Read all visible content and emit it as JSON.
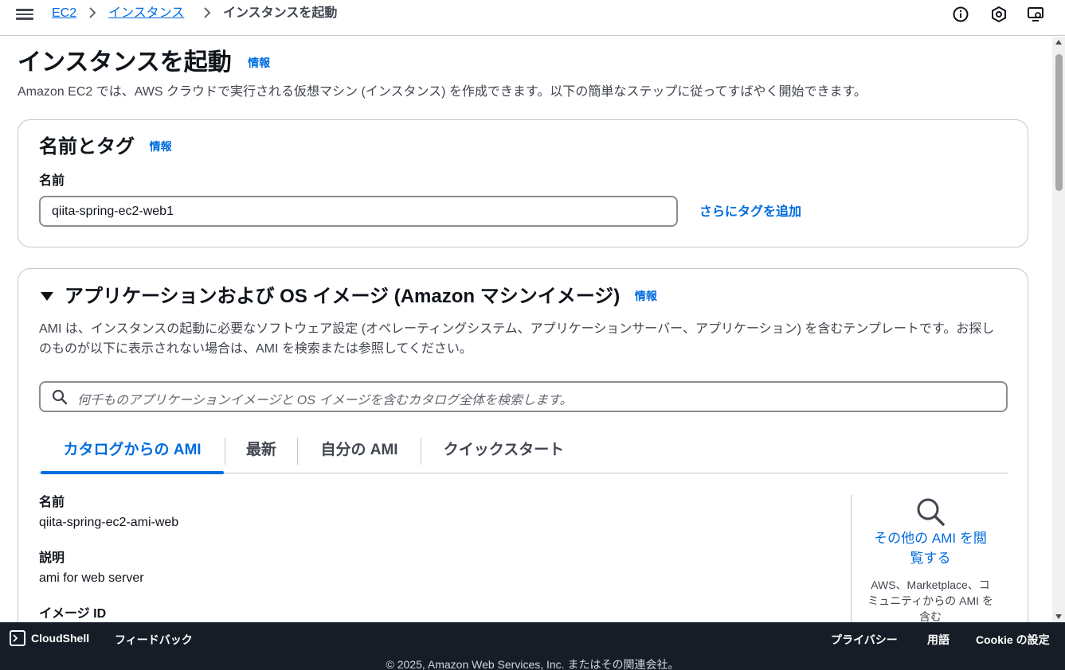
{
  "breadcrumb": {
    "items": [
      "EC2",
      "インスタンス",
      "インスタンスを起動"
    ]
  },
  "page": {
    "title": "インスタンスを起動",
    "info": "情報",
    "description": "Amazon EC2 では、AWS クラウドで実行される仮想マシン (インスタンス) を作成できます。以下の簡単なステップに従ってすばやく開始できます。"
  },
  "name_tags": {
    "title": "名前とタグ",
    "info": "情報",
    "name_label": "名前",
    "name_value": "qiita-spring-ec2-web1",
    "add_tags": "さらにタグを追加"
  },
  "ami": {
    "title": "アプリケーションおよび OS イメージ (Amazon マシンイメージ)",
    "info": "情報",
    "description": "AMI は、インスタンスの起動に必要なソフトウェア設定 (オペレーティングシステム、アプリケーションサーバー、アプリケーション) を含むテンプレートです。お探しのものが以下に表示されない場合は、AMI を検索または参照してください。",
    "search_placeholder": "何千ものアプリケーションイメージと OS イメージを含むカタログ全体を検索します。",
    "tabs": [
      "カタログからの AMI",
      "最新",
      "自分の AMI",
      "クイックスタート"
    ],
    "active_tab": 0,
    "details": {
      "name_label": "名前",
      "name_value": "qiita-spring-ec2-ami-web",
      "desc_label": "説明",
      "desc_value": "ami for web server",
      "image_id_label": "イメージ ID"
    },
    "browse": {
      "link": "その他の AMI を閲覧する",
      "sub": "AWS、Marketplace、コミュニティからの AMI を含む"
    }
  },
  "footer": {
    "cloudshell": "CloudShell",
    "feedback": "フィードバック",
    "privacy": "プライバシー",
    "terms": "用語",
    "cookie": "Cookie の設定",
    "copyright": "© 2025, Amazon Web Services, Inc. またはその関連会社。"
  },
  "icons": {
    "menu": "hamburger-menu-icon",
    "info": "info-circle-icon",
    "notifications": "hexagon-notification-icon",
    "settings": "screen-settings-icon",
    "search": "search-icon",
    "caret": "caret-down-icon",
    "cloudshell": "terminal-icon"
  },
  "colors": {
    "link": "#006ce0",
    "footer_bg": "#161d26",
    "border": "#c6c6cd"
  }
}
